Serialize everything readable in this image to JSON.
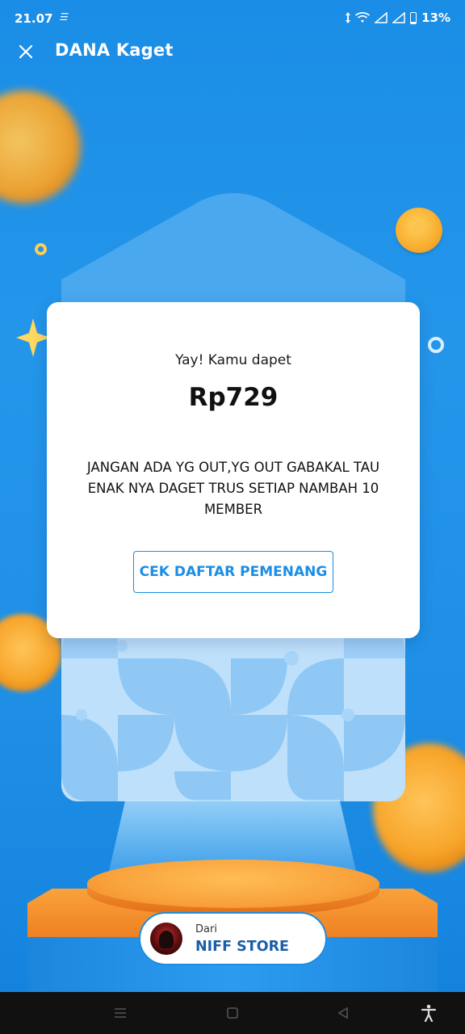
{
  "status_bar": {
    "time": "21.07",
    "battery_percent": "13%"
  },
  "header": {
    "title": "DANA Kaget",
    "close_icon": "close-icon"
  },
  "card": {
    "greeting": "Yay! Kamu dapet",
    "amount": "Rp729",
    "message": "JANGAN ADA YG OUT,YG OUT GABAKAL TAU ENAK NYA DAGET TRUS SETIAP NAMBAH 10 MEMBER",
    "button_label": "CEK DAFTAR PEMENANG"
  },
  "sender": {
    "label": "Dari",
    "name": "NIFF STORE"
  },
  "colors": {
    "accent": "#1a8ee5",
    "background": "#1b8fe6",
    "coin": "#f7a52a"
  },
  "navbar": {
    "icons": [
      "menu-icon",
      "home-square-icon",
      "back-triangle-icon",
      "accessibility-icon"
    ]
  }
}
